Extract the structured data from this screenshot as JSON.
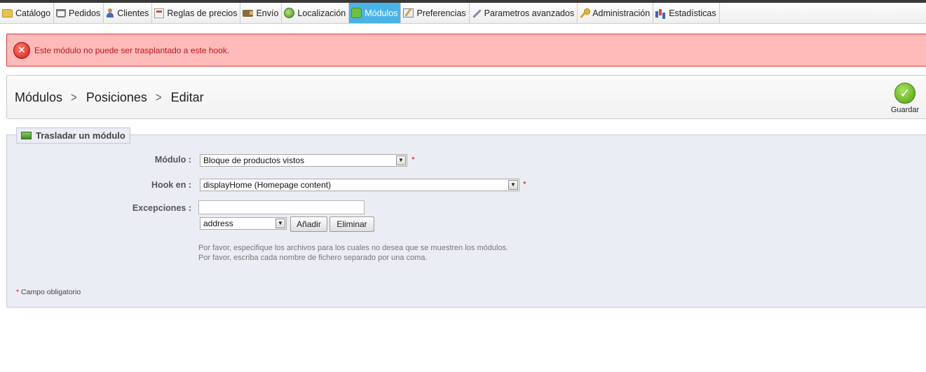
{
  "nav": {
    "items": [
      {
        "label": "Catálogo",
        "icon": "folder-icon"
      },
      {
        "label": "Pedidos",
        "icon": "cart-icon"
      },
      {
        "label": "Clientes",
        "icon": "user-icon"
      },
      {
        "label": "Reglas de precios",
        "icon": "price-rules-icon"
      },
      {
        "label": "Envío",
        "icon": "truck-icon"
      },
      {
        "label": "Localización",
        "icon": "globe-icon"
      },
      {
        "label": "Módulos",
        "icon": "puzzle-icon",
        "active": true
      },
      {
        "label": "Preferencias",
        "icon": "preferences-icon"
      },
      {
        "label": "Parametros avanzados",
        "icon": "wrench-icon"
      },
      {
        "label": "Administración",
        "icon": "key-icon"
      },
      {
        "label": "Estadísticas",
        "icon": "stats-icon"
      }
    ],
    "active_color": "#49b3e8"
  },
  "error": {
    "message": "Este módulo no puede ser trasplantado a este hook.",
    "icon": "error-x-icon",
    "color": "#ffbaba"
  },
  "toolbar": {
    "breadcrumb": [
      "Módulos",
      "Posiciones",
      "Editar"
    ],
    "save_label": "Guardar",
    "save_icon": "checkmark-icon"
  },
  "form": {
    "legend": "Trasladar un módulo",
    "module_label": "Módulo :",
    "module_value": "Bloque de productos vistos",
    "hook_label": "Hook en :",
    "hook_value": "displayHome (Homepage content)",
    "exceptions_label": "Excepciones :",
    "exceptions_value": "",
    "file_select_value": "address",
    "add_label": "Añadir",
    "remove_label": "Eliminar",
    "required_marker": "*",
    "hint_line1": "Por favor, especifique los archivos para los cuales no desea que se muestren los módulos.",
    "hint_line2": "Por favor, escriba cada nombre de fichero separado por una coma.",
    "required_note": "Campo obligatorio"
  }
}
